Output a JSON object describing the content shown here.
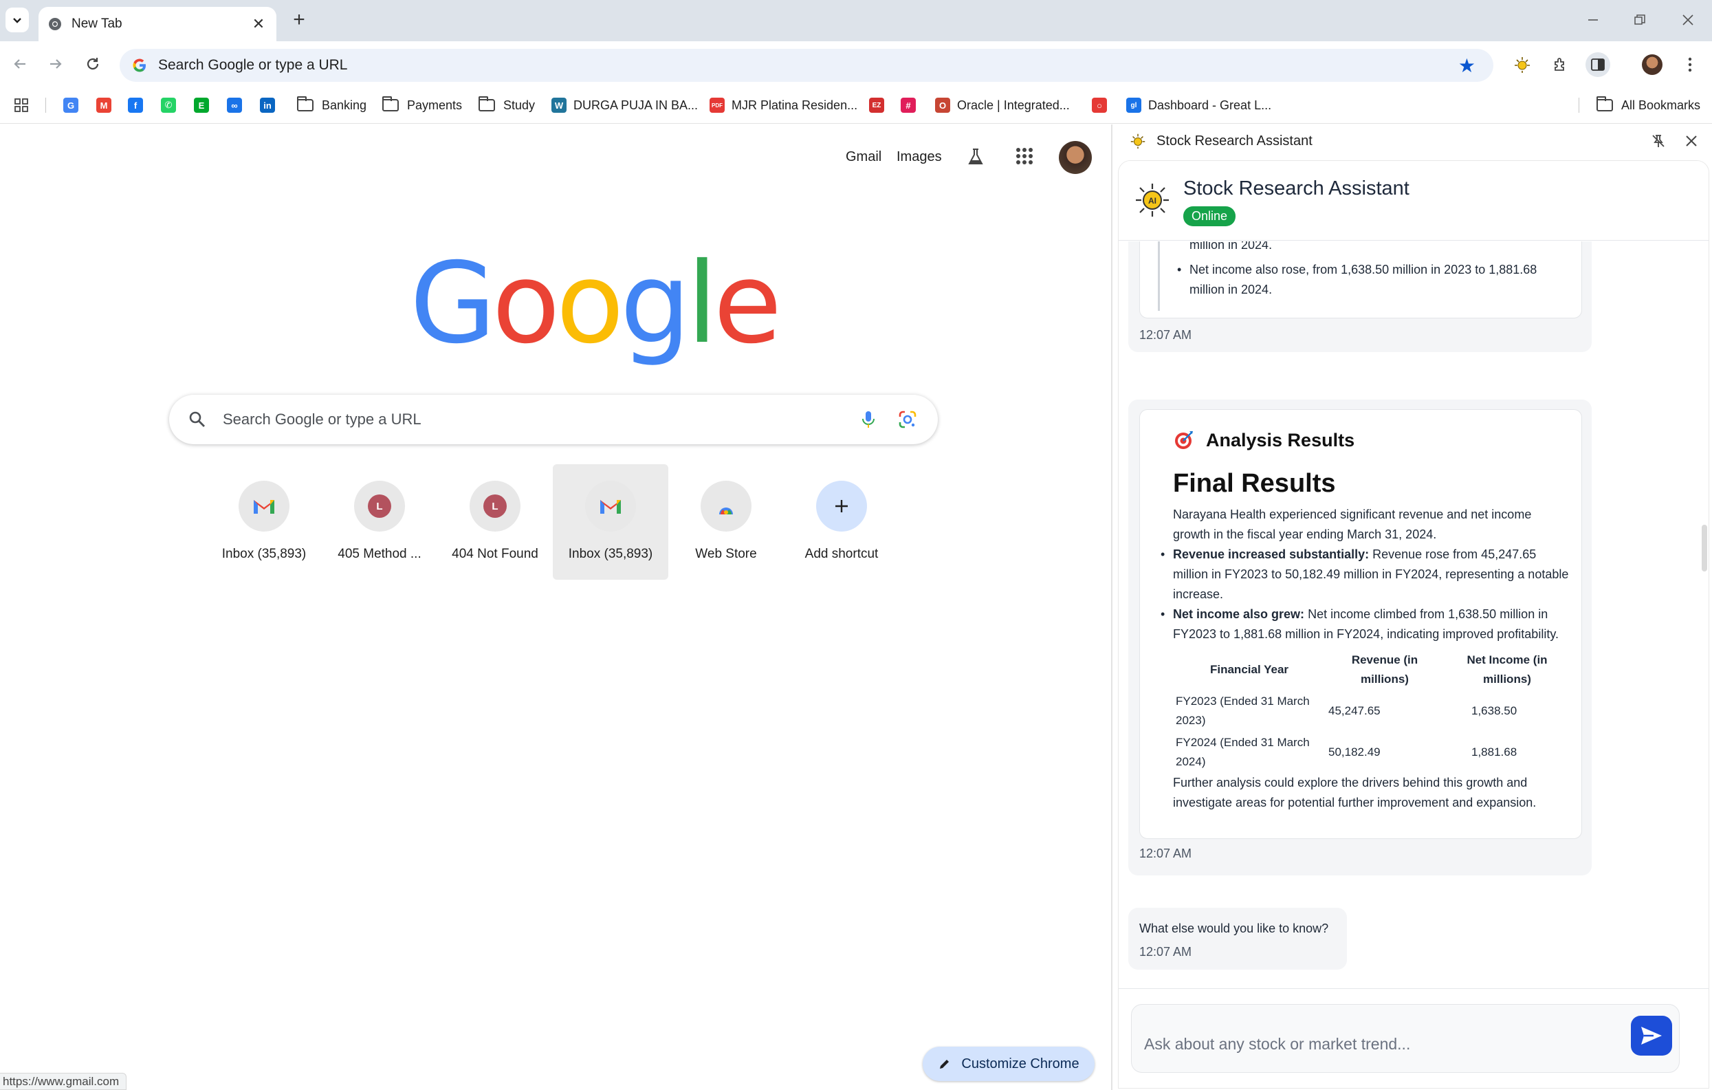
{
  "browser": {
    "tab": {
      "title": "New Tab"
    },
    "omnibox": {
      "text": "Search Google or type a URL"
    },
    "bookmarks": [
      {
        "label": "",
        "icon": "google-icon",
        "color": "#4285f4"
      },
      {
        "label": "",
        "icon": "gmail-icon",
        "color": "#ea4335"
      },
      {
        "label": "",
        "icon": "facebook-icon",
        "color": "#1877f2"
      },
      {
        "label": "",
        "icon": "whatsapp-icon",
        "color": "#25d366"
      },
      {
        "label": "",
        "icon": "evernote-icon",
        "color": "#00a82d"
      },
      {
        "label": "",
        "icon": "link-icon",
        "color": "#1a73e8"
      },
      {
        "label": "",
        "icon": "linkedin-icon",
        "color": "#0a66c2"
      },
      {
        "label": "Banking",
        "icon": "folder-icon"
      },
      {
        "label": "Payments",
        "icon": "folder-icon"
      },
      {
        "label": "Study",
        "icon": "folder-icon"
      },
      {
        "label": "DURGA PUJA IN BA...",
        "icon": "wordpress-icon",
        "color": "#21759b"
      },
      {
        "label": "MJR Platina Residen...",
        "icon": "pdf-icon",
        "color": "#e53935"
      },
      {
        "label": "",
        "icon": "ez-icon",
        "color": "#d32f2f"
      },
      {
        "label": "",
        "icon": "slack-icon",
        "color": "#e01e5a"
      },
      {
        "label": "Oracle | Integrated...",
        "icon": "oracle-icon",
        "color": "#c74634"
      },
      {
        "label": "",
        "icon": "ring-icon",
        "color": "#e53935"
      },
      {
        "label": "Dashboard - Great L...",
        "icon": "greatlearning-icon",
        "color": "#1a73e8"
      }
    ],
    "all_bookmarks": "All Bookmarks",
    "status_url": "https://www.gmail.com"
  },
  "ntp": {
    "gmail": "Gmail",
    "images": "Images",
    "logo": [
      "G",
      "o",
      "o",
      "g",
      "l",
      "e"
    ],
    "logo_colors": [
      "#4285f4",
      "#ea4335",
      "#fbbc05",
      "#4285f4",
      "#34a853",
      "#ea4335"
    ],
    "search_placeholder": "Search Google or type a URL",
    "shortcuts": [
      {
        "label": "Inbox (35,893)",
        "icon": "gmail-icon"
      },
      {
        "label": "405 Method ...",
        "icon": "letter-l-icon",
        "letter": "L"
      },
      {
        "label": "404 Not Found",
        "icon": "letter-l-icon",
        "letter": "L"
      },
      {
        "label": "Inbox (35,893)",
        "icon": "gmail-icon"
      },
      {
        "label": "Web Store",
        "icon": "webstore-icon"
      },
      {
        "label": "Add shortcut",
        "icon": "plus-icon"
      }
    ],
    "customize": "Customize Chrome"
  },
  "panel": {
    "header_title": "Stock Research Assistant",
    "app_title": "Stock Research Assistant",
    "status": "Online",
    "colors": {
      "online": "#16a34a",
      "send": "#1d4ed8"
    },
    "msg1": {
      "partial_line": "million in 2024.",
      "bullet": "Net income also rose, from 1,638.50 million in 2023 to 1,881.68 million in 2024.",
      "time": "12:07 AM"
    },
    "msg2": {
      "heading": "Analysis Results",
      "title": "Final Results",
      "intro": "Narayana Health experienced significant revenue and net income growth in the fiscal year ending March 31, 2024.",
      "bullets": [
        {
          "bold": "Revenue increased substantially:",
          "text": " Revenue rose from 45,247.65 million in FY2023 to 50,182.49 million in FY2024, representing a notable increase."
        },
        {
          "bold": "Net income also grew:",
          "text": " Net income climbed from 1,638.50 million in FY2023 to 1,881.68 million in FY2024, indicating improved profitability."
        }
      ],
      "table": {
        "headers": [
          "Financial Year",
          "Revenue (in millions)",
          "Net Income (in millions)"
        ],
        "rows": [
          [
            "FY2023 (Ended 31 March 2023)",
            "45,247.65",
            "1,638.50"
          ],
          [
            "FY2024 (Ended 31 March 2024)",
            "50,182.49",
            "1,881.68"
          ]
        ]
      },
      "outro": "Further analysis could explore the drivers behind this growth and investigate areas for potential further improvement and expansion.",
      "time": "12:07 AM"
    },
    "msg3": {
      "text": "What else would you like to know?",
      "time": "12:07 AM"
    },
    "input_placeholder": "Ask about any stock or market trend..."
  }
}
